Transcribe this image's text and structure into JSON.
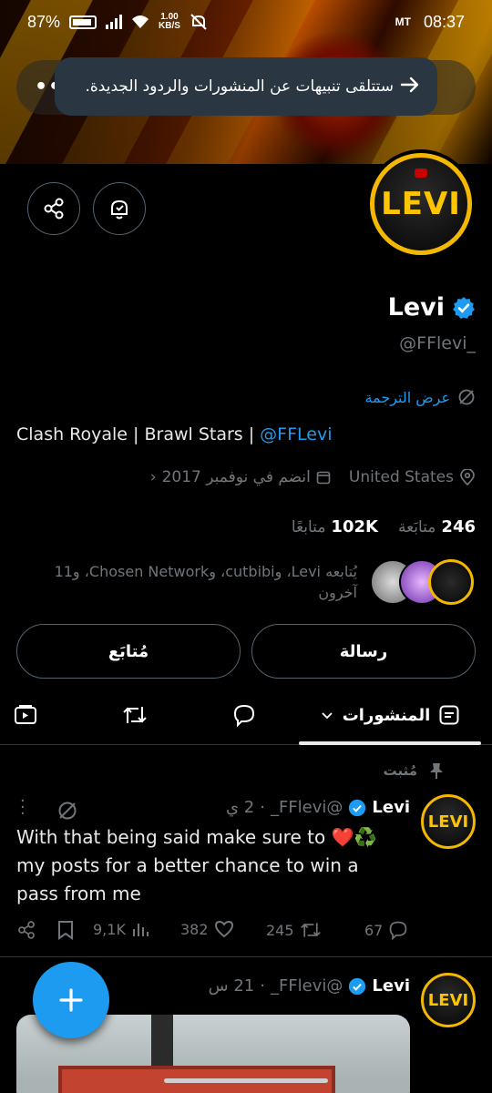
{
  "status_bar": {
    "battery": "87%",
    "speed_value": "1.00",
    "speed_unit": "KB/S",
    "carrier": "MT",
    "time": "08:37"
  },
  "toast": {
    "message": "ستتلقى تنبيهات عن المنشورات والردود الجديدة."
  },
  "profile": {
    "avatar_text": "LEVI",
    "name": "Levi",
    "handle": "@FFlevi_",
    "translate_label": "عرض الترجمة",
    "bio_text": "Clash Royale | Brawl Stars | ",
    "bio_mention": "@FFLevi",
    "location": "United States",
    "joined": "انضم في نوفمبر 2017",
    "following_count": "246",
    "following_label": "متابَعة",
    "followers_count": "102K",
    "followers_label": "متابعًا",
    "followed_by_line1": "يُتابعه Levi، وcutbibi، وChosen Network، و11",
    "followed_by_line2": "آخرون",
    "message_button": "رسالة",
    "follow_button": "مُتابَع"
  },
  "tabs": {
    "posts_label": "المنشورات"
  },
  "colors": {
    "accent": "#1d9bf0",
    "gold": "#f5b800",
    "muted": "#71767b",
    "heart": "#e0245e"
  },
  "posts": [
    {
      "pinned_label": "مُثبت",
      "name": "Levi",
      "handle": "@FFlevi_",
      "time": "2 ي",
      "text": "With that being said make sure to ❤️♻️ my posts for a better chance to win a pass from me",
      "replies": "67",
      "reposts": "245",
      "likes": "382",
      "views": "9,1K"
    },
    {
      "name": "Levi",
      "handle": "@FFlevi_",
      "time": "21 س"
    }
  ],
  "icons": [
    "share-icon",
    "notification-bell-icon",
    "verified-badge-icon",
    "translate-icon",
    "location-icon",
    "calendar-icon",
    "pin-icon",
    "compose-plus-icon"
  ]
}
